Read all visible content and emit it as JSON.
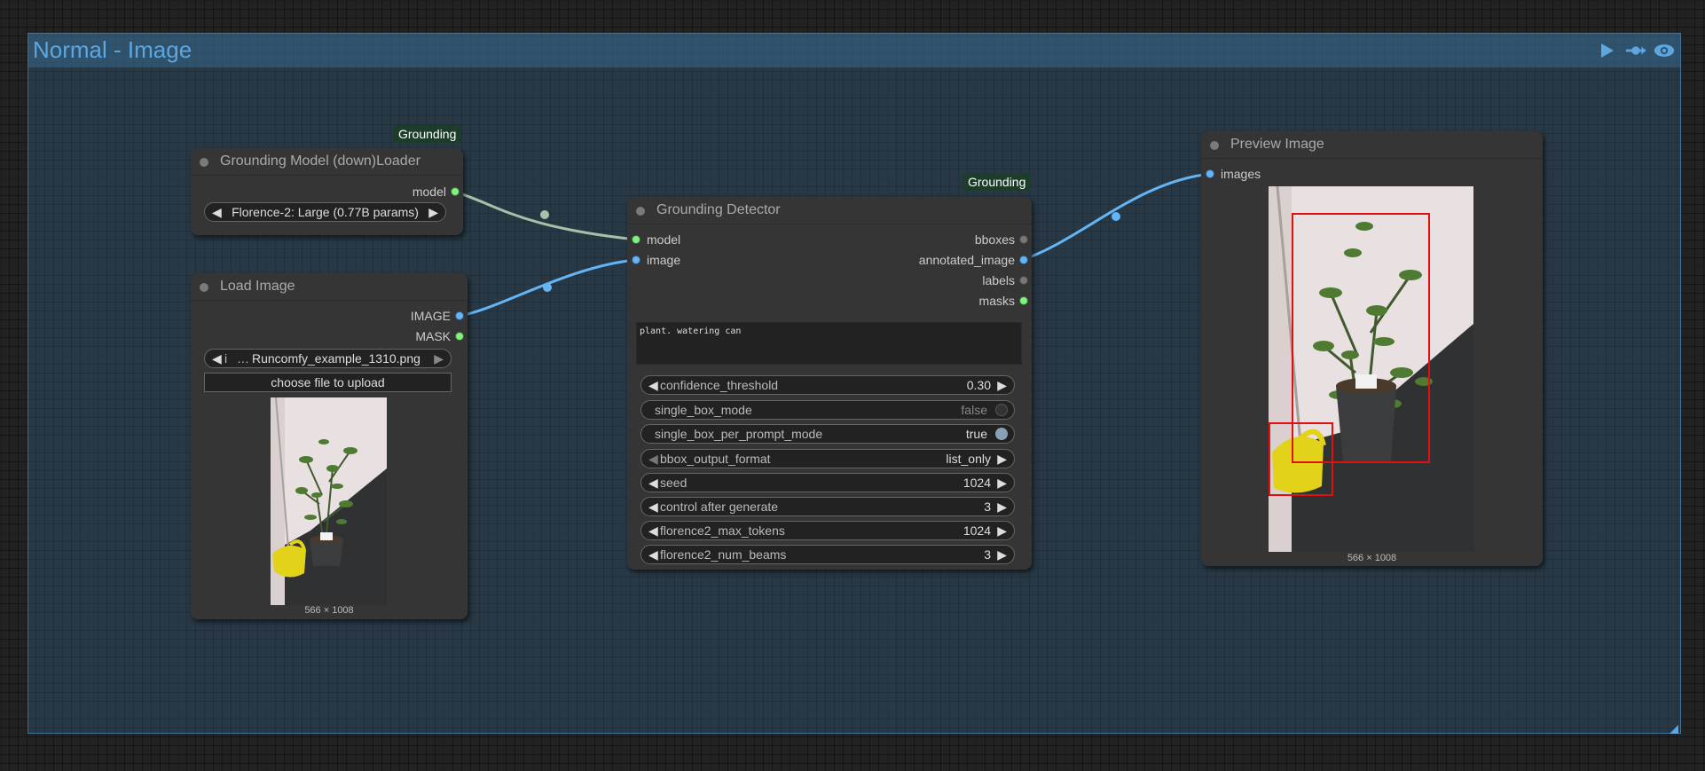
{
  "group": {
    "title": "Normal - Image"
  },
  "nodes": {
    "loader": {
      "title": "Grounding Model (down)Loader",
      "badge": "Grounding",
      "output_model": "model",
      "model_value": "Florence-2: Large (0.77B params)"
    },
    "load_image": {
      "title": "Load Image",
      "output_image": "IMAGE",
      "output_mask": "MASK",
      "image_prefix": "i",
      "image_ellipsis": "…",
      "image_value": "Runcomfy_example_1310.png",
      "upload_label": "choose file to upload",
      "dims": "566 × 1008"
    },
    "detector": {
      "title": "Grounding Detector",
      "badge": "Grounding",
      "input_model": "model",
      "input_image": "image",
      "output_bboxes": "bboxes",
      "output_annotated": "annotated_image",
      "output_labels": "labels",
      "output_masks": "masks",
      "prompt": "plant. watering can",
      "widgets": [
        {
          "label": "confidence_threshold",
          "value": "0.30"
        },
        {
          "label": "single_box_mode",
          "value": "false"
        },
        {
          "label": "single_box_per_prompt_mode",
          "value": "true"
        },
        {
          "label": "bbox_output_format",
          "value": "list_only"
        },
        {
          "label": "seed",
          "value": "1024"
        },
        {
          "label": "control after generate",
          "value": "3"
        },
        {
          "label": "florence2_max_tokens",
          "value": "1024"
        },
        {
          "label": "florence2_num_beams",
          "value": "3"
        }
      ]
    },
    "preview": {
      "title": "Preview Image",
      "input_images": "images",
      "dims": "566 × 1008"
    }
  },
  "colors": {
    "accent": "#5ea6e0",
    "model_socket": "#7cf37c",
    "image_socket": "#64b5f6",
    "model_link": "#a8c0a8",
    "image_link": "#64b5f6",
    "bbox": "#e01010"
  },
  "icons": [
    "play-icon",
    "link-icon",
    "eye-icon"
  ]
}
